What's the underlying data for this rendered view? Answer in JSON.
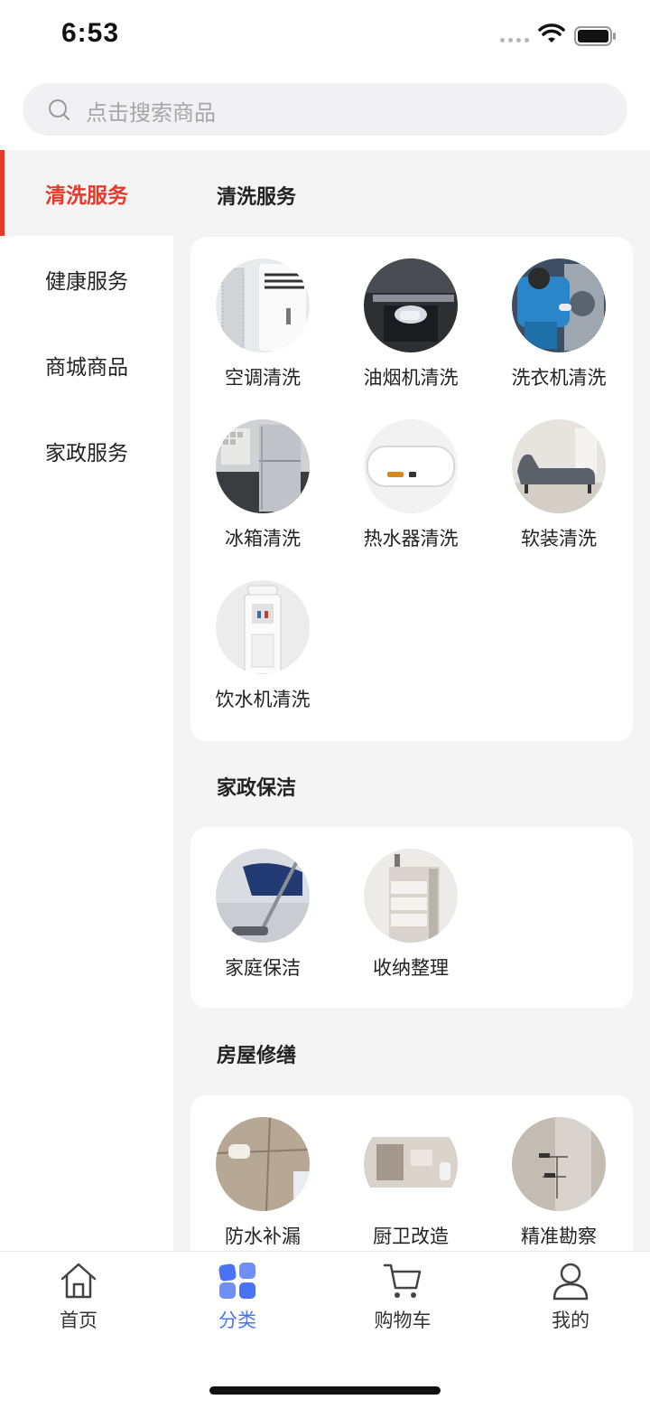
{
  "status": {
    "time": "6:53"
  },
  "search": {
    "placeholder": "点击搜索商品"
  },
  "sidebar": {
    "items": [
      {
        "label": "清洗服务",
        "active": true
      },
      {
        "label": "健康服务",
        "active": false
      },
      {
        "label": "商城商品",
        "active": false
      },
      {
        "label": "家政服务",
        "active": false
      }
    ]
  },
  "sections": [
    {
      "title": "清洗服务",
      "items": [
        {
          "label": "空调清洗",
          "icon": "air-conditioner"
        },
        {
          "label": "油烟机清洗",
          "icon": "range-hood"
        },
        {
          "label": "洗衣机清洗",
          "icon": "washing-machine"
        },
        {
          "label": "冰箱清洗",
          "icon": "refrigerator"
        },
        {
          "label": "热水器清洗",
          "icon": "water-heater"
        },
        {
          "label": "软装清洗",
          "icon": "sofa"
        },
        {
          "label": "饮水机清洗",
          "icon": "water-dispenser"
        }
      ]
    },
    {
      "title": "家政保洁",
      "items": [
        {
          "label": "家庭保洁",
          "icon": "vacuum-cleaning"
        },
        {
          "label": "收纳整理",
          "icon": "storage-cabinet"
        }
      ]
    },
    {
      "title": "房屋修缮",
      "items": [
        {
          "label": "防水补漏",
          "icon": "waterproofing"
        },
        {
          "label": "厨卫改造",
          "icon": "bathroom"
        },
        {
          "label": "精准勘察",
          "icon": "inspection"
        }
      ]
    }
  ],
  "tabbar": {
    "items": [
      {
        "label": "首页",
        "icon": "home-icon",
        "active": false
      },
      {
        "label": "分类",
        "icon": "category-icon",
        "active": true
      },
      {
        "label": "购物车",
        "icon": "cart-icon",
        "active": false
      },
      {
        "label": "我的",
        "icon": "user-icon",
        "active": false
      }
    ]
  },
  "colors": {
    "accent": "#e53a2a",
    "tab_active": "#4a72f5",
    "background": "#f4f4f5"
  }
}
